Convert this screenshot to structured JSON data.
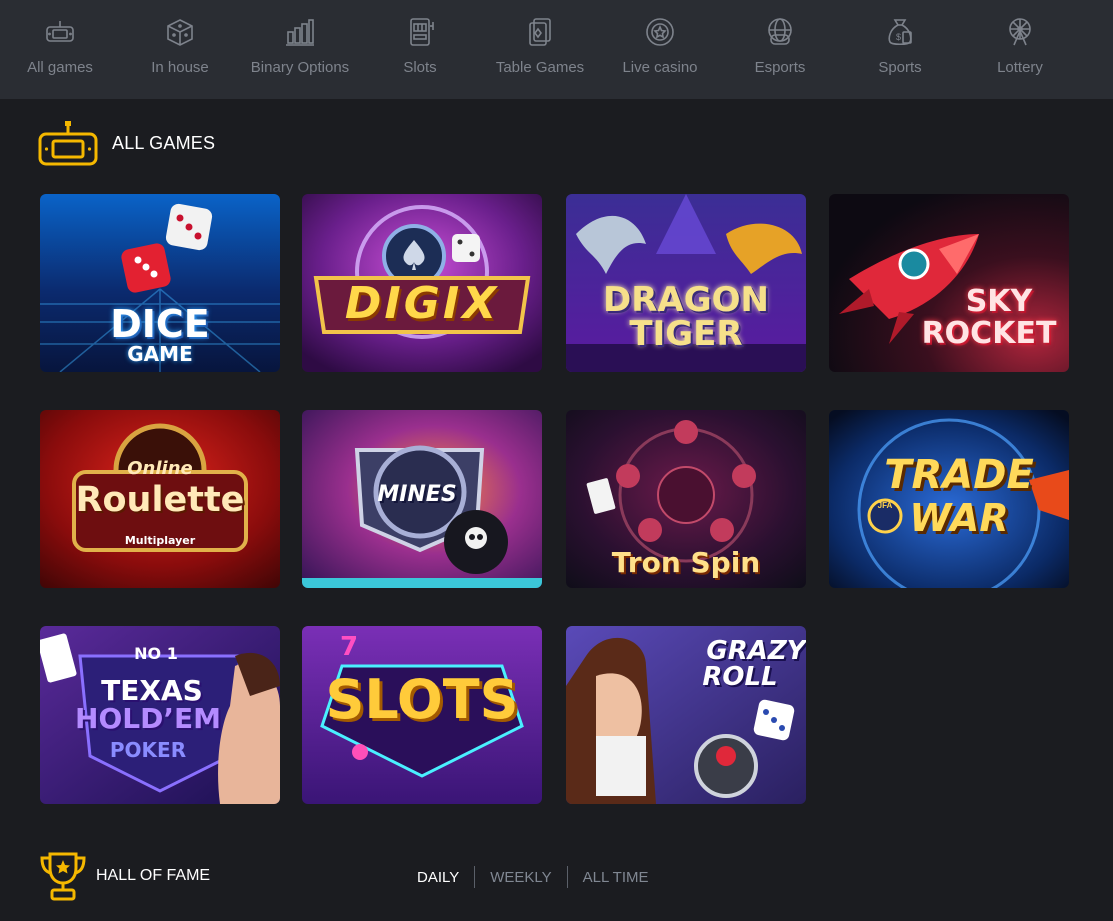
{
  "nav": [
    {
      "label": "All games",
      "icon": "gamepad-icon"
    },
    {
      "label": "In house",
      "icon": "cube-icon"
    },
    {
      "label": "Binary Options",
      "icon": "bar-chart-icon"
    },
    {
      "label": "Slots",
      "icon": "slot-machine-icon"
    },
    {
      "label": "Table Games",
      "icon": "cards-icon"
    },
    {
      "label": "Live casino",
      "icon": "casino-chip-icon"
    },
    {
      "label": "Esports",
      "icon": "globe-controller-icon"
    },
    {
      "label": "Sports",
      "icon": "money-bag-icon"
    },
    {
      "label": "Lottery",
      "icon": "ferris-wheel-icon"
    }
  ],
  "all_games": {
    "title": "ALL GAMES",
    "icon": "gamepad-icon",
    "accent": "#f5b800"
  },
  "games": [
    {
      "line1": "DICE",
      "line2": "GAME"
    },
    {
      "line1": "DIGIX",
      "line2": ""
    },
    {
      "line1": "DRAGON",
      "line2": "TIGER"
    },
    {
      "line1": "SKY",
      "line2": "ROCKET"
    },
    {
      "line0": "Online",
      "line1": "Roulette",
      "line2": "Multiplayer"
    },
    {
      "line1": "MINES",
      "line2": ""
    },
    {
      "line1": "Tron Spin",
      "line2": ""
    },
    {
      "line1": "TRADE",
      "line2": "WAR",
      "badge": "JFA"
    },
    {
      "line0": "NO 1",
      "line1": "TEXAS",
      "line2": "HOLD’EM",
      "line3": "POKER"
    },
    {
      "line1": "SLOTS",
      "line2": ""
    },
    {
      "line1": "GRAZY",
      "line2": "ROLL"
    }
  ],
  "hall_of_fame": {
    "title": "HALL OF FAME",
    "icon": "trophy-icon",
    "tabs": [
      "DAILY",
      "WEEKLY",
      "ALL TIME"
    ],
    "active_tab": "DAILY"
  }
}
